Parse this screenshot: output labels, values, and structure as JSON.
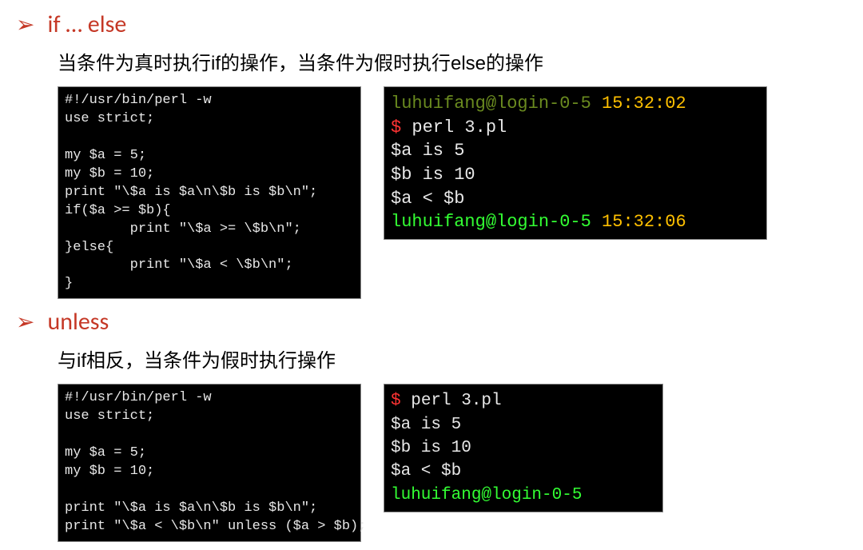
{
  "section1": {
    "heading": "if … else",
    "desc": "当条件为真时执行if的操作，当条件为假时执行else的操作",
    "code_left": [
      "#!/usr/bin/perl -w",
      "use strict;",
      "",
      "my $a = 5;",
      "my $b = 10;",
      "print \"\\$a is $a\\n\\$b is $b\\n\";",
      "if($a >= $b){",
      "        print \"\\$a >= \\$b\\n\";",
      "}else{",
      "        print \"\\$a < \\$b\\n\";",
      "}"
    ],
    "right": {
      "top_prompt": "luhuifang@login-0-5",
      "top_time": "15:32:02",
      "cmd": "perl 3.pl",
      "out1": "$a is 5",
      "out2": "$b is 10",
      "out3": "$a < $b",
      "end_prompt": "luhuifang@login-0-5",
      "end_time": "15:32:06"
    }
  },
  "section2": {
    "heading": "unless",
    "desc": "与if相反，当条件为假时执行操作",
    "code_left": [
      "#!/usr/bin/perl -w",
      "use strict;",
      "",
      "my $a = 5;",
      "my $b = 10;",
      "",
      "print \"\\$a is $a\\n\\$b is $b\\n\";",
      "print \"\\$a < \\$b\\n\" unless ($a > $b);"
    ],
    "right": {
      "cmd": "perl 3.pl",
      "out1": "$a is 5",
      "out2": "$b is 10",
      "out3": "$a < $b",
      "end_prompt": "luhuifang@login-0-5"
    }
  }
}
